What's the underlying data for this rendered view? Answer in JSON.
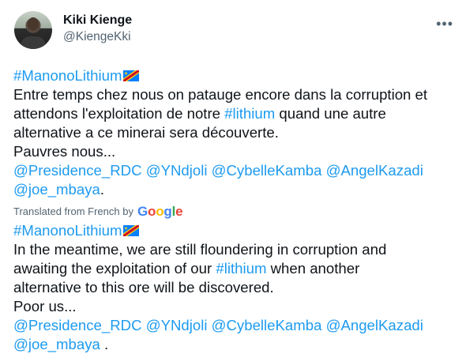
{
  "author": {
    "display_name": "Kiki Kienge",
    "handle": "@KiengeKki"
  },
  "more_icon": "ellipsis-icon",
  "original": {
    "hashtag": "#ManonoLithium",
    "line1": "Entre temps chez nous on patauge encore dans la corruption et",
    "line2_pre": "attendons l'exploitation de notre ",
    "line2_link": "#lithium",
    "line2_post": " quand une autre",
    "line3": "alternative a ce minerai sera découverte.",
    "line4": "Pauvres nous...",
    "mentions1": "@Presidence_RDC @YNdjoli @CybelleKamba @AngelKazadi",
    "mentions2": "@joe_mbaya",
    "mentions2_suffix": "."
  },
  "translation_label": "Translated from French by",
  "translation_brand": "Google",
  "translated": {
    "hashtag": "#ManonoLithium",
    "line1": "In the meantime, we are still floundering in corruption and",
    "line2_pre": "awaiting the exploitation of our ",
    "line2_link": "#lithium",
    "line2_post": " when another",
    "line3": "alternative to this ore will be discovered.",
    "line4": "Poor us...",
    "mentions1": "@Presidence_RDC @YNdjoli @CybelleKamba @AngelKazadi",
    "mentions2": "@joe_mbaya",
    "mentions2_suffix": " ."
  },
  "colors": {
    "link": "#1d9bf0",
    "secondary_text": "#536471",
    "flag_blue": "#007fff",
    "flag_red": "#ce1021",
    "flag_yellow": "#f7d618"
  }
}
